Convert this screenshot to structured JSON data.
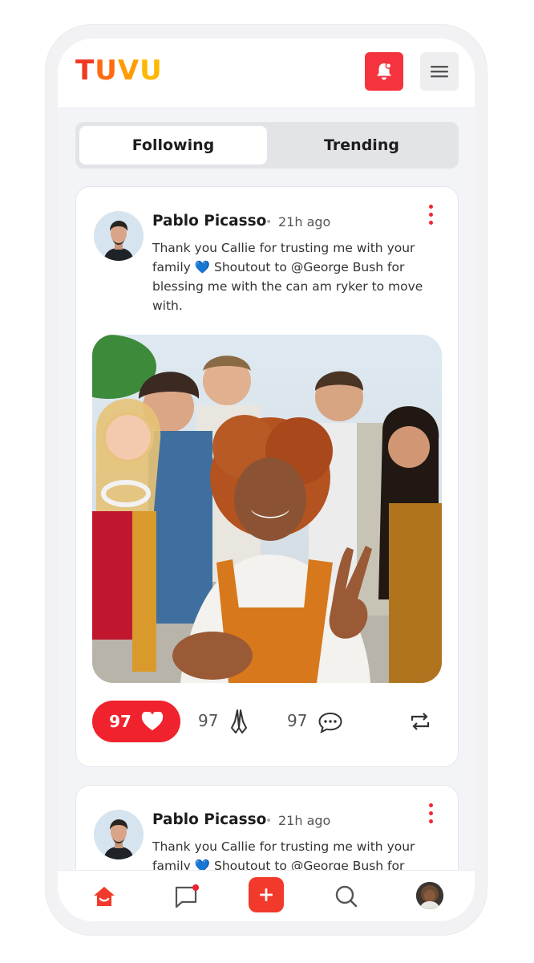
{
  "app": {
    "logo": "TUVU"
  },
  "colors": {
    "accent": "#f0222d",
    "logo_orange": "#ff7a00",
    "logo_yellow": "#ffb400"
  },
  "header": {
    "notification_icon": "bell-icon",
    "menu_icon": "hamburger-icon"
  },
  "tabs": [
    {
      "label": "Following",
      "active": true
    },
    {
      "label": "Trending",
      "active": false
    }
  ],
  "posts": [
    {
      "author": "Pablo Picasso",
      "separator": "•",
      "time": "21h ago",
      "text": "Thank you Callie for trusting me with your family 💙 Shoutout to @George Bush for blessing me with the can am ryker to move with.",
      "likes": "97",
      "prayers": "97",
      "comments": "97"
    },
    {
      "author": "Pablo Picasso",
      "separator": "•",
      "time": "21h ago",
      "text": "Thank you Callie for trusting me with your family 💙 Shoutout to @George Bush for"
    }
  ],
  "bottom_nav": [
    {
      "name": "home",
      "icon": "home-icon",
      "active": true
    },
    {
      "name": "messages",
      "icon": "chat-icon",
      "badge": true
    },
    {
      "name": "create",
      "icon": "plus-icon"
    },
    {
      "name": "search",
      "icon": "search-icon"
    },
    {
      "name": "profile",
      "icon": "avatar"
    }
  ]
}
